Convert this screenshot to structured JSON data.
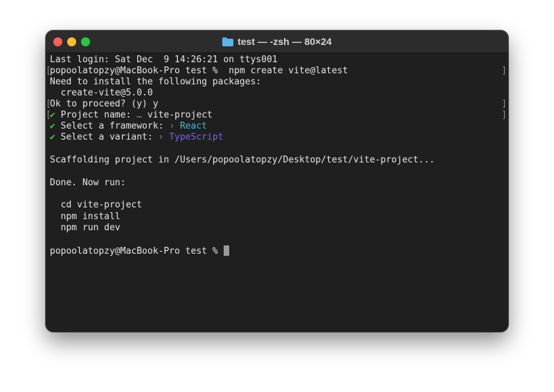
{
  "window": {
    "title": "test — -zsh — 80×24",
    "folder_icon": "folder-icon",
    "traffic_lights": {
      "close": "#ff5f57",
      "minimize": "#febc2e",
      "maximize": "#28c840"
    }
  },
  "terminal": {
    "last_login": "Last login: Sat Dec  9 14:26:21 on ttys001",
    "prompt": "popoolatopzy@MacBook-Pro test %",
    "command": "npm create vite@latest",
    "install_notice": "Need to install the following packages:",
    "package": "create-vite@5.0.0",
    "proceed": "Ok to proceed? (y) y",
    "check_mark": "✔",
    "prompts": [
      {
        "label": "Project name:",
        "separator": "…",
        "value": "vite-project"
      },
      {
        "label": "Select a framework:",
        "separator": "›",
        "value": "React"
      },
      {
        "label": "Select a variant:",
        "separator": "›",
        "value": "TypeScript"
      }
    ],
    "scaffolding": "Scaffolding project in /Users/popoolatopzy/Desktop/test/vite-project...",
    "done": "Done. Now run:",
    "next_steps": [
      "cd vite-project",
      "npm install",
      "npm run dev"
    ],
    "final_prompt": "popoolatopzy@MacBook-Pro test %",
    "colors": {
      "check": "#3ec73e",
      "react": "#3fb9d6",
      "typescript": "#7b62e8"
    }
  }
}
